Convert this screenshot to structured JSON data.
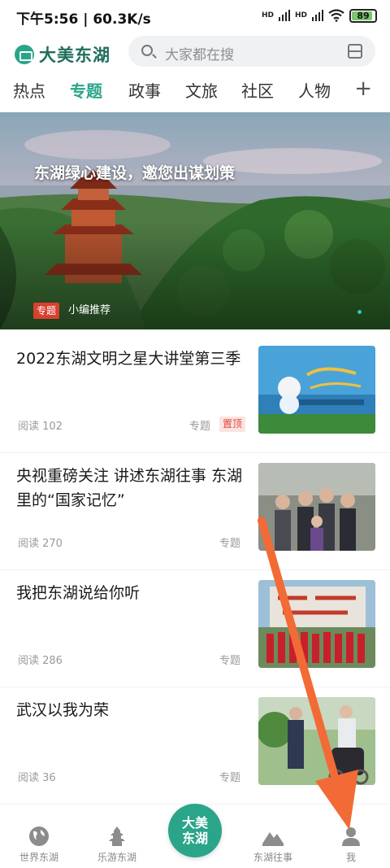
{
  "status_bar": {
    "left_text": "下午5:56 | 60.3K/s",
    "signal_1": "HD",
    "signal_2": "HD",
    "battery": "89",
    "battery_level": 0.89
  },
  "header": {
    "logo_text": "大美东湖",
    "search_placeholder": "大家都在搜"
  },
  "tabs": [
    {
      "label": "热点",
      "active": false
    },
    {
      "label": "专题",
      "active": true
    },
    {
      "label": "政事",
      "active": false
    },
    {
      "label": "文旅",
      "active": false
    },
    {
      "label": "社区",
      "active": false
    },
    {
      "label": "人物",
      "active": false
    }
  ],
  "tab_add": "+",
  "banner": {
    "title": "东湖绿心建设，邀您出谋划策",
    "tag": "专题",
    "subtitle": "小编推荐"
  },
  "articles": [
    {
      "title": "2022东湖文明之星大讲堂第三季",
      "meta": "阅读 102",
      "category": "专题",
      "top": "置顶"
    },
    {
      "title": "央视重磅关注 讲述东湖往事 东湖里的“国家记忆”",
      "meta": "阅读 270",
      "category": "专题"
    },
    {
      "title": "我把东湖说给你听",
      "meta": "阅读 286",
      "category": "专题"
    },
    {
      "title": "武汉以我为荣",
      "meta": "阅读 36",
      "category": "专题"
    }
  ],
  "nav": {
    "items": [
      {
        "label": "世界东湖",
        "icon": "globe-icon"
      },
      {
        "label": "乐游东湖",
        "icon": "pagoda-icon"
      },
      {
        "label": "东湖往事",
        "icon": "mountain-icon"
      },
      {
        "label": "我",
        "icon": "person-icon"
      }
    ],
    "center_line1": "大美",
    "center_line2": "东湖"
  },
  "colors": {
    "accent": "#2aa58a",
    "tag_red": "#d8402f",
    "arrow": "#f26a35"
  }
}
